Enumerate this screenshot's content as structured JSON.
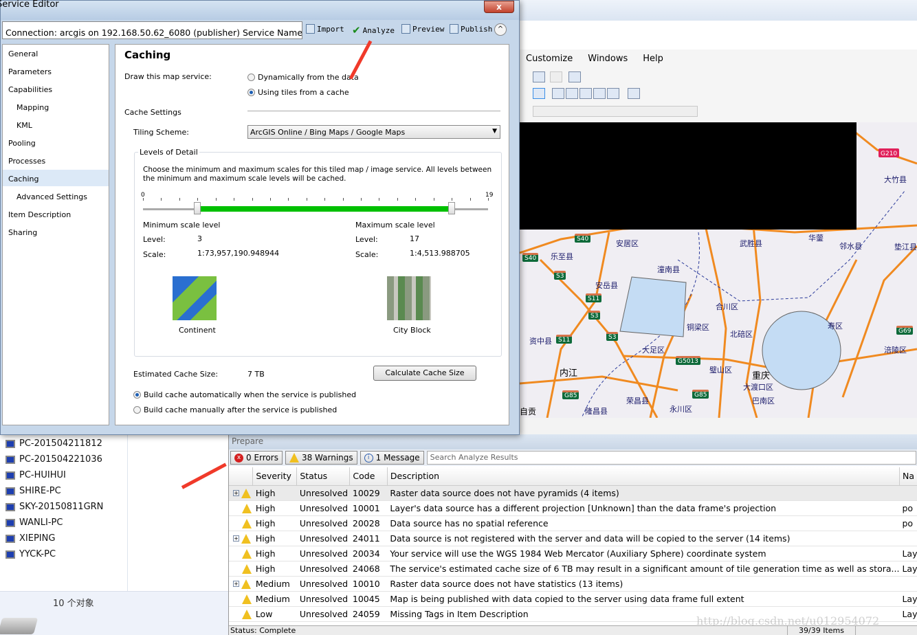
{
  "editor": {
    "title": "Service Editor",
    "close": "x",
    "connection": "Connection: arcgis on 192.168.50.62_6080 (publisher)    Service Name: 重...",
    "toolbar": {
      "import": "Import",
      "analyze": "Analyze",
      "preview": "Preview",
      "publish": "Publish",
      "collapse": "^"
    },
    "nav": [
      "General",
      "Parameters",
      "Capabilities",
      "Mapping",
      "KML",
      "Pooling",
      "Processes",
      "Caching",
      "Advanced Settings",
      "Item Description",
      "Sharing"
    ],
    "caching": {
      "heading": "Caching",
      "draw_label": "Draw this map service:",
      "opt_dynamic": "Dynamically from the data",
      "opt_tiles": "Using tiles from a cache",
      "selected": "Using tiles from a cache",
      "cache_settings": "Cache Settings",
      "tiling_label": "Tiling Scheme:",
      "tiling_value": "ArcGIS Online / Bing Maps / Google Maps",
      "lod_title": "Levels of Detail",
      "lod_desc": "Choose the minimum and maximum scales for this tiled map / image service. All levels between the minimum and maximum scale levels will be cached.",
      "slider_min": "0",
      "slider_max": "19",
      "min_level_value": 3,
      "max_level_value": 17,
      "min_title": "Minimum scale level",
      "max_title": "Maximum scale level",
      "level_label": "Level:",
      "scale_label": "Scale:",
      "min_level": "3",
      "min_scale": "1:73,957,190.948944",
      "max_level": "17",
      "max_scale": "1:4,513.988705",
      "min_thumb": "Continent",
      "max_thumb": "City Block",
      "est_label": "Estimated Cache Size:",
      "est_value": "7 TB",
      "calc_button": "Calculate Cache Size",
      "build_auto": "Build cache automatically when the service is published",
      "build_manual": "Build cache manually after the service is published"
    }
  },
  "arcmap": {
    "menu": [
      "Customize",
      "Windows",
      "Help"
    ],
    "map_labels": [
      "安居区",
      "乐至县",
      "武胜县",
      "华蓥",
      "邻水县",
      "垫江县",
      "潼南县",
      "安岳县",
      "合川区",
      "铜梁区",
      "北碚区",
      "寿区",
      "资中县",
      "大足区",
      "内江",
      "璧山区",
      "重庆",
      "大渡口区",
      "涪陵区",
      "巴南区",
      "荣昌县",
      "永川区",
      "隆昌县",
      "自贡",
      "大竹县"
    ],
    "shields": [
      "S40",
      "S40",
      "S3",
      "S11",
      "S3",
      "S3",
      "S11",
      "G5013",
      "G85",
      "G85",
      "G210",
      "G69"
    ]
  },
  "explorer": {
    "items": [
      "PC-201504211812",
      "PC-201504221036",
      "PC-HUIHUI",
      "SHIRE-PC",
      "SKY-20150811GRN",
      "WANLI-PC",
      "XIEPING",
      "YYCK-PC"
    ],
    "count": "10 个对象"
  },
  "prepare": {
    "title": "Prepare",
    "errors": "0 Errors",
    "warnings": "38 Warnings",
    "messages": "1 Message",
    "search_placeholder": "Search Analyze Results",
    "columns": [
      "Severity",
      "Status",
      "Code",
      "Description",
      "Na"
    ],
    "rows": [
      {
        "expand": true,
        "severity": "High",
        "status": "Unresolved",
        "code": "10029",
        "description": "Raster data source does not have pyramids (4 items)",
        "name": ""
      },
      {
        "expand": false,
        "severity": "High",
        "status": "Unresolved",
        "code": "10001",
        "description": "Layer's data source has a different projection [Unknown] than the data frame's projection",
        "name": "po"
      },
      {
        "expand": false,
        "severity": "High",
        "status": "Unresolved",
        "code": "20028",
        "description": "Data source has no spatial reference",
        "name": "po"
      },
      {
        "expand": true,
        "severity": "High",
        "status": "Unresolved",
        "code": "24011",
        "description": "Data source is not registered with the server and data will be copied to the server (14 items)",
        "name": ""
      },
      {
        "expand": false,
        "severity": "High",
        "status": "Unresolved",
        "code": "20034",
        "description": "Your service will use the WGS 1984 Web Mercator (Auxiliary Sphere) coordinate system",
        "name": "Lay"
      },
      {
        "expand": false,
        "severity": "High",
        "status": "Unresolved",
        "code": "24068",
        "description": "The service's estimated cache size of 6 TB may result in a significant amount of tile generation time as well as stora...",
        "name": "Lay"
      },
      {
        "expand": true,
        "severity": "Medium",
        "status": "Unresolved",
        "code": "10010",
        "description": "Raster data source does not have statistics (13 items)",
        "name": ""
      },
      {
        "expand": false,
        "severity": "Medium",
        "status": "Unresolved",
        "code": "10045",
        "description": "Map is being published with data copied to the server using data frame full extent",
        "name": "Lay"
      },
      {
        "expand": false,
        "severity": "Low",
        "status": "Unresolved",
        "code": "24059",
        "description": "Missing Tags in Item Description",
        "name": "Lay"
      }
    ],
    "status": "Status: Complete",
    "items": "39/39 Items"
  },
  "watermark": "http://blog.csdn.net/u012954072",
  "colors": {
    "slider_fill": "#00c000",
    "arrow": "#f03a2a",
    "selected_nav": "#dce9f7"
  }
}
